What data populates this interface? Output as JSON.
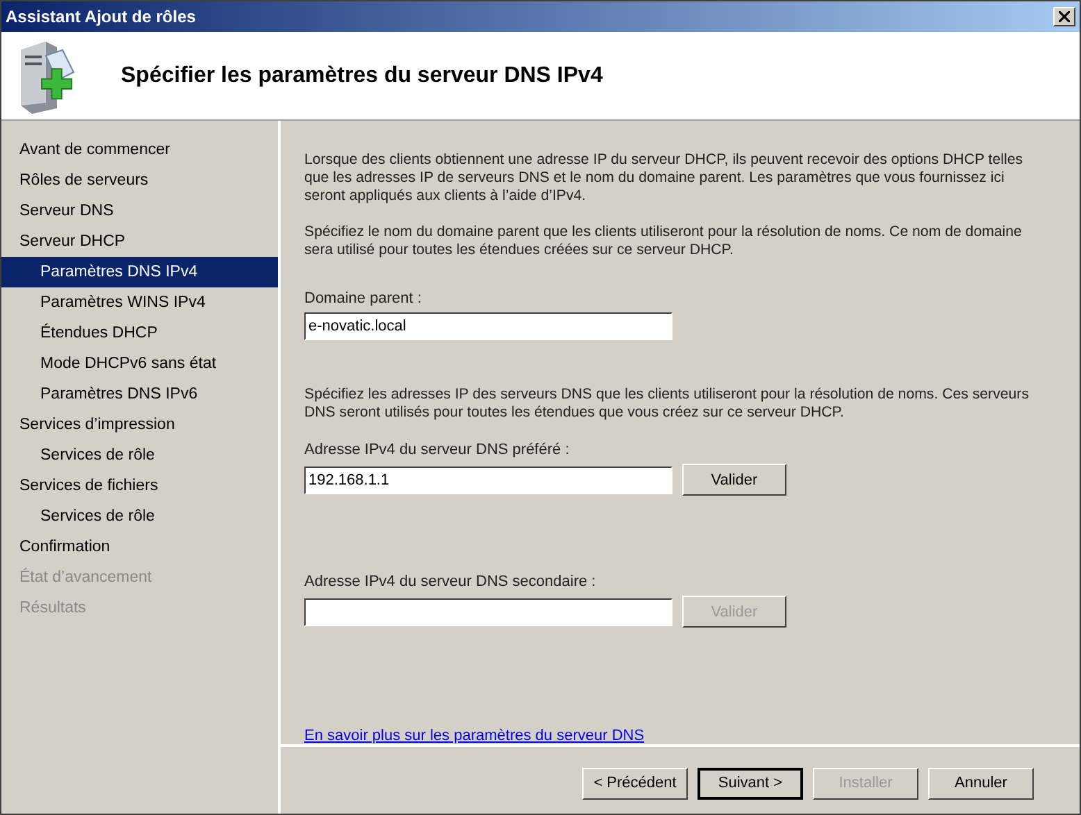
{
  "window": {
    "title": "Assistant Ajout de rôles"
  },
  "header": {
    "title": "Spécifier les paramètres du serveur DNS IPv4"
  },
  "steps": [
    {
      "label": "Avant de commencer",
      "selected": false,
      "disabled": false
    },
    {
      "label": "Rôles de serveurs",
      "selected": false,
      "disabled": false
    },
    {
      "label": "Serveur DNS",
      "selected": false,
      "disabled": false
    },
    {
      "label": "Serveur DHCP",
      "selected": false,
      "disabled": false,
      "children": [
        {
          "label": "Paramètres DNS IPv4",
          "selected": true,
          "disabled": false
        },
        {
          "label": "Paramètres WINS IPv4",
          "selected": false,
          "disabled": false
        },
        {
          "label": "Étendues DHCP",
          "selected": false,
          "disabled": false
        },
        {
          "label": "Mode DHCPv6 sans état",
          "selected": false,
          "disabled": false
        },
        {
          "label": "Paramètres DNS IPv6",
          "selected": false,
          "disabled": false
        }
      ]
    },
    {
      "label": "Services d’impression",
      "selected": false,
      "disabled": false,
      "children": [
        {
          "label": "Services de rôle",
          "selected": false,
          "disabled": false
        }
      ]
    },
    {
      "label": "Services de fichiers",
      "selected": false,
      "disabled": false,
      "children": [
        {
          "label": "Services de rôle",
          "selected": false,
          "disabled": false
        }
      ]
    },
    {
      "label": "Confirmation",
      "selected": false,
      "disabled": false
    },
    {
      "label": "État d’avancement",
      "selected": false,
      "disabled": true
    },
    {
      "label": "Résultats",
      "selected": false,
      "disabled": true
    }
  ],
  "intro": "Lorsque des clients obtiennent une adresse IP du serveur DHCP, ils peuvent recevoir des options DHCP telles que les adresses IP de serveurs DNS et le nom du domaine parent. Les paramètres que vous fournissez ici seront appliqués aux clients à l’aide d’IPv4.",
  "domain_text": "Spécifiez le nom du domaine parent que les clients utiliseront pour la résolution de noms. Ce nom de domaine sera utilisé pour toutes les étendues créées sur ce serveur DHCP.",
  "domain_field": {
    "label": "Domaine parent :",
    "value": "e-novatic.local"
  },
  "dns_text": "Spécifiez les adresses IP des serveurs DNS que les clients utiliseront pour la résolution de noms. Ces serveurs DNS seront utilisés pour toutes les étendues que vous créez sur ce serveur DHCP.",
  "dns_fields": [
    {
      "label": "Adresse IPv4 du serveur DNS préféré :",
      "value": "192.168.1.1",
      "button": "Valider",
      "disabled": false
    },
    {
      "label": "Adresse IPv4 du serveur DNS secondaire :",
      "button": "Valider",
      "disabled": true
    }
  ],
  "link": "En savoir plus sur les paramètres du serveur DNS",
  "buttons": [
    {
      "label": "< Précédent",
      "disabled": false,
      "default": false
    },
    {
      "label": "Suivant >",
      "disabled": false,
      "default": true
    },
    {
      "label": "Installer",
      "disabled": true,
      "default": false
    },
    {
      "label": "Annuler",
      "disabled": false,
      "default": false
    }
  ]
}
